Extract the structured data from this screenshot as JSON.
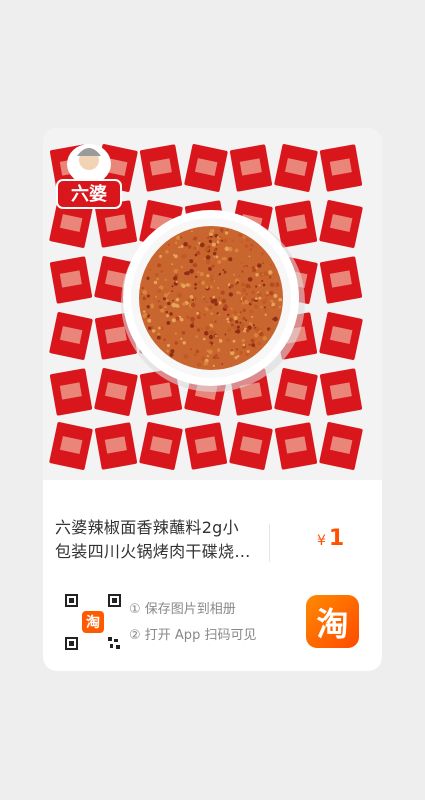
{
  "product": {
    "title": "六婆辣椒面香辣蘸料2g小包装四川火锅烤肉干碟烧烤...",
    "price_symbol": "¥",
    "price_value": "1",
    "brand_logo_text": "六婆",
    "image_name": "product-photo"
  },
  "share": {
    "step1": "① 保存图片到相册",
    "step2": "② 打开 App 扫码可见",
    "app_icon_glyph": "淘",
    "qr_center_glyph": "淘"
  },
  "colors": {
    "accent": "#ff5000",
    "app_icon_start": "#ff8a00",
    "app_icon_end": "#ff4a00",
    "packet_red": "#d8161b",
    "powder": "#c9652e"
  }
}
